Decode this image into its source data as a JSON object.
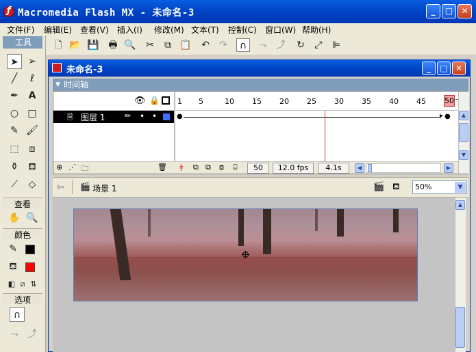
{
  "app": {
    "title": "Macromedia Flash MX - 未命名-3",
    "minimize": "_",
    "maximize": "□",
    "close": "✕"
  },
  "menu": [
    "文件(F)",
    "编辑(E)",
    "查看(V)",
    "插入(I)",
    "修改(M)",
    "文本(T)",
    "控制(C)",
    "窗口(W)",
    "帮助(H)"
  ],
  "toolbox": {
    "title": "工具",
    "sections": {
      "view": "查看",
      "colors": "颜色",
      "options": "选项"
    },
    "stroke_color": "#000000",
    "fill_color": "#ff0000"
  },
  "document": {
    "title": "未命名-3"
  },
  "timeline": {
    "header": "时间轴",
    "ticks": [
      "1",
      "5",
      "10",
      "15",
      "20",
      "25",
      "30",
      "35",
      "40",
      "45",
      "50"
    ],
    "layer_name": "图层 1",
    "current_frame": "50",
    "fps": "12.0 fps",
    "elapsed": "4.1s"
  },
  "scene": {
    "name": "场景 1",
    "zoom": "50%"
  },
  "colors": {
    "titlebar": "#0046c8",
    "chrome": "#ece9d8",
    "playhead": "#e03030"
  }
}
